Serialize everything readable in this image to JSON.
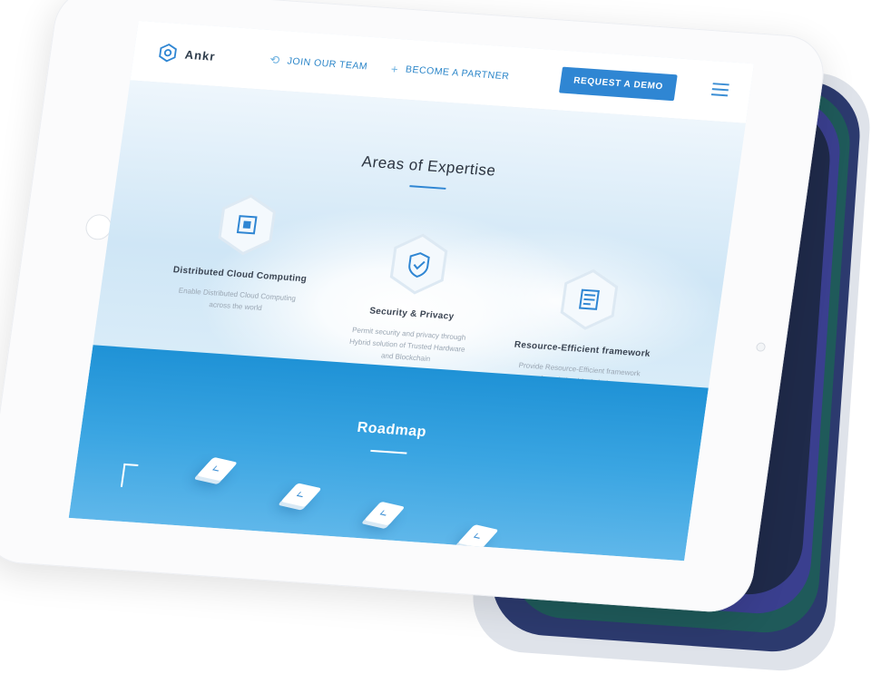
{
  "nav": {
    "brand": "Ankr",
    "join_team": "JOIN OUR TEAM",
    "become_partner": "BECOME A PARTNER",
    "request_demo": "REQUEST A DEMO",
    "icons": {
      "join": "link-icon",
      "partner": "plus-icon",
      "menu": "hamburger-icon"
    }
  },
  "expertise": {
    "title": "Areas of Expertise",
    "cards": [
      {
        "title": "Distributed Cloud Computing",
        "desc": "Enable Distributed Cloud Computing across the world",
        "icon": "chip-icon"
      },
      {
        "title": "Security & Privacy",
        "desc": "Permit security and privacy through Hybrid solution of Trusted Hardware and Blockchain",
        "icon": "shield-icon"
      },
      {
        "title": "Resource-Efficient framework",
        "desc": "Provide Resource-Efficient framework for existing blockchains",
        "icon": "document-icon"
      }
    ]
  },
  "roadmap": {
    "title": "Roadmap"
  },
  "colors": {
    "accent": "#2f86d3",
    "roadmap_bg": "#1f92d6",
    "text_dark": "#2c3440",
    "device_shadow": "#3a3f8f"
  }
}
